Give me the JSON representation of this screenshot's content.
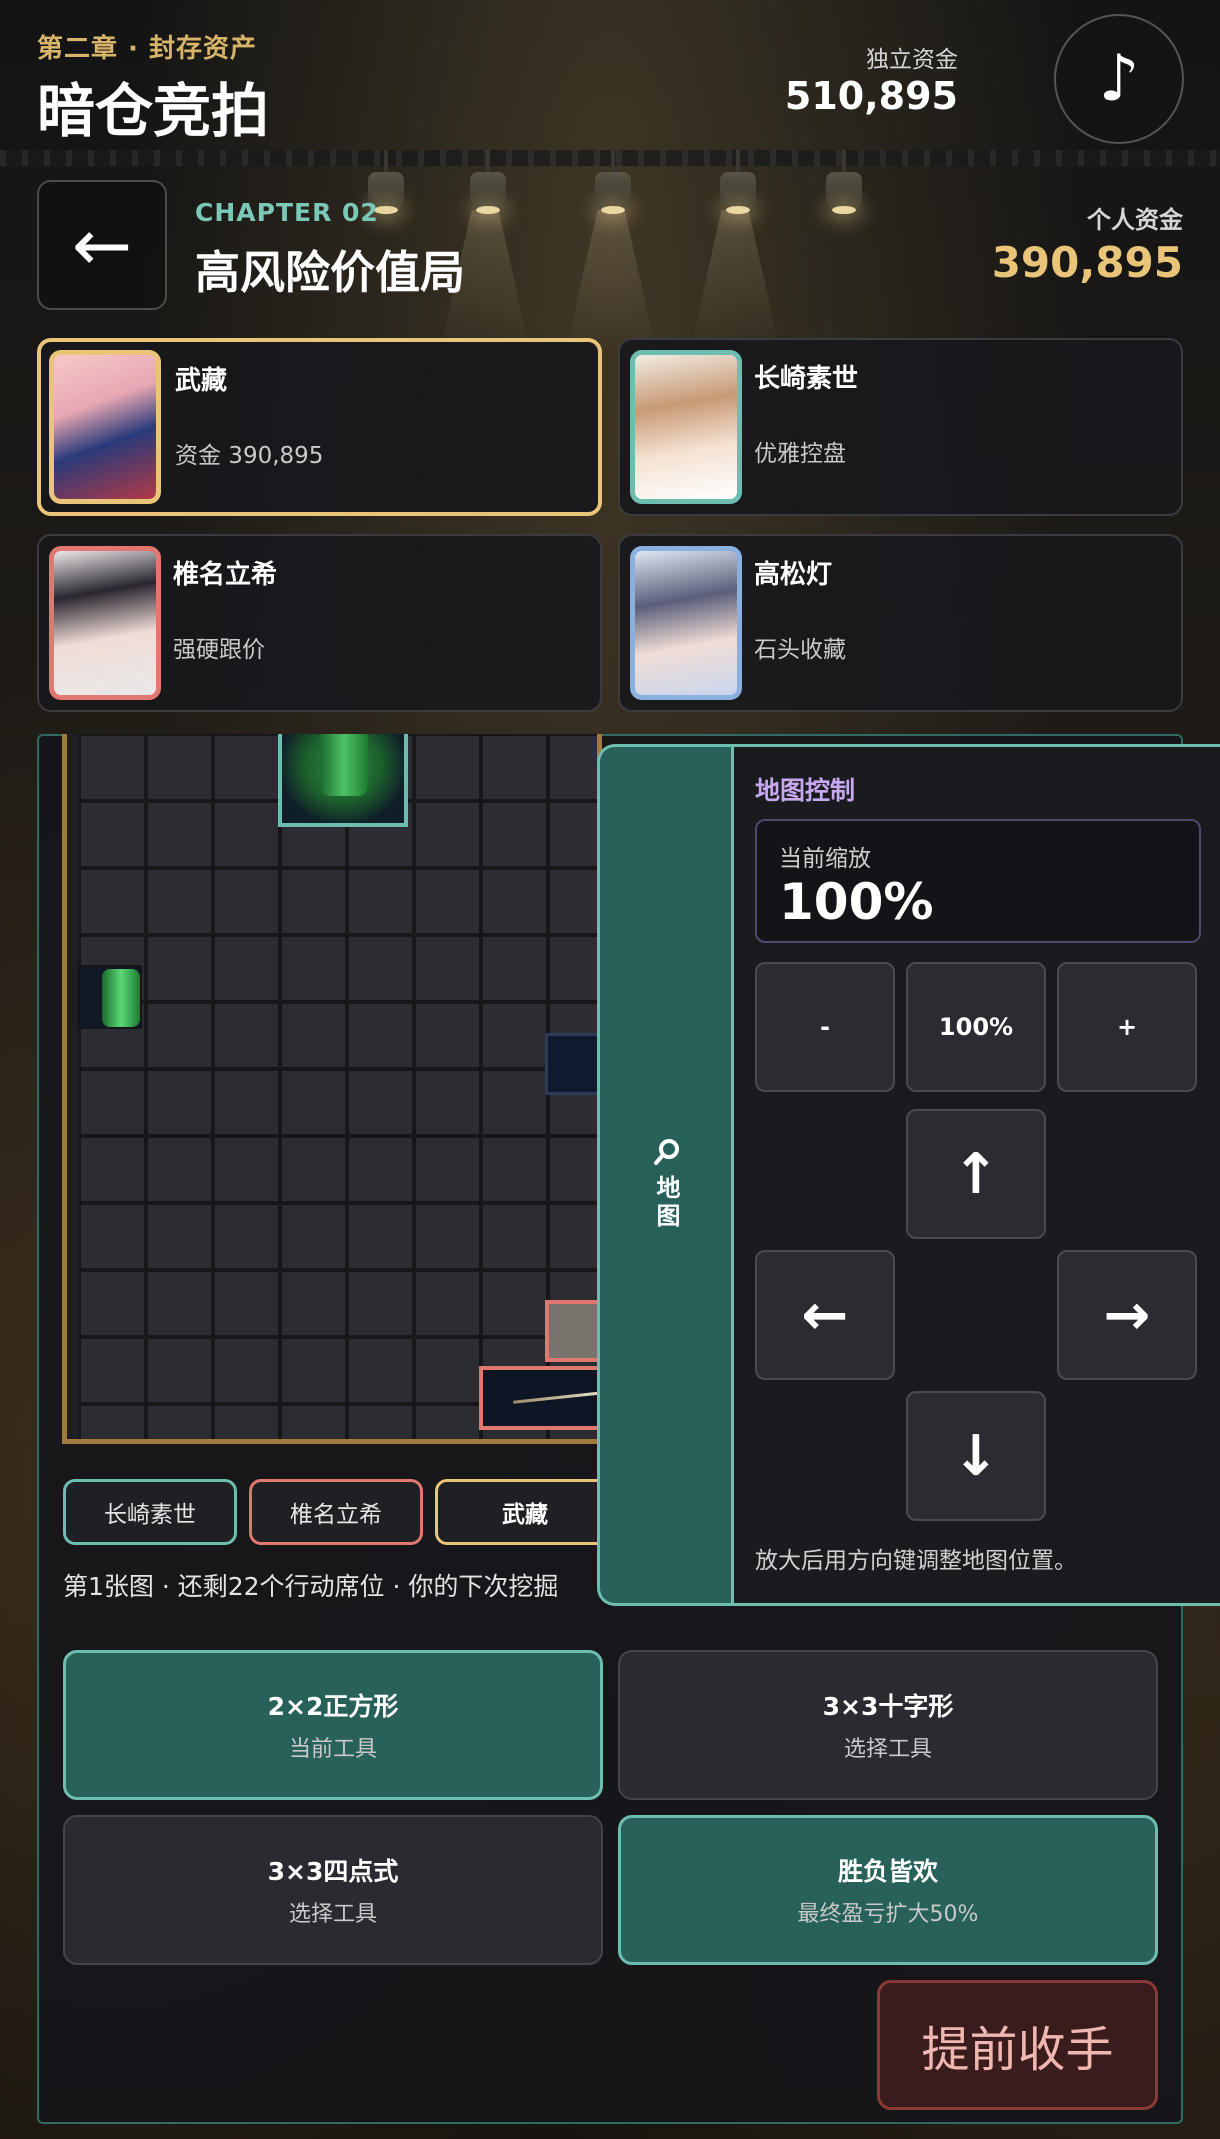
{
  "header": {
    "chapter_subtitle": "第二章 · 封存资产",
    "title": "暗仓竞拍",
    "fund_label": "独立资金",
    "fund_value": "510,895",
    "music_symbol": "♪"
  },
  "chapter": {
    "back_arrow": "←",
    "code": "CHAPTER 02",
    "title": "高风险价值局",
    "personal_fund_label": "个人资金",
    "personal_fund_value": "390,895"
  },
  "players": [
    {
      "name": "武藏",
      "subtitle": "资金 390,895",
      "color": "#e9c479",
      "active": true
    },
    {
      "name": "长崎素世",
      "subtitle": "优雅控盘",
      "color": "#6dbdb0",
      "active": false
    },
    {
      "name": "椎名立希",
      "subtitle": "强硬跟价",
      "color": "#e07870",
      "active": false
    },
    {
      "name": "高松灯",
      "subtitle": "石头收藏",
      "color": "#8ab0e0",
      "active": false
    }
  ],
  "board_tabs": [
    "长崎素世",
    "椎名立希",
    "武藏"
  ],
  "status_line": "第1张图 · 还剩22个行动席位 · 你的下次挖掘",
  "tools": [
    {
      "name": "2×2正方形",
      "subtitle": "当前工具",
      "selected": true
    },
    {
      "name": "3×3十字形",
      "subtitle": "选择工具",
      "selected": false
    },
    {
      "name": "3×3四点式",
      "subtitle": "选择工具",
      "selected": false
    },
    {
      "name": "胜负皆欢",
      "subtitle": "最终盈亏扩大50%",
      "selected": true
    }
  ],
  "quit_label": "提前收手",
  "map_control": {
    "tab_icon": "search-icon",
    "tab_label": "地图",
    "title": "地图控制",
    "zoom_label": "当前缩放",
    "zoom_value": "100%",
    "zoom_out_label": "-",
    "zoom_reset_label": "100%",
    "zoom_in_label": "+",
    "up_arrow": "↑",
    "left_arrow": "←",
    "right_arrow": "→",
    "down_arrow": "↓",
    "hint": "放大后用方向键调整地图位置。"
  },
  "colors": {
    "accent_gold": "#e9c479",
    "accent_teal": "#6dbdb0",
    "accent_red": "#e07870",
    "panel_green": "#28615a"
  }
}
